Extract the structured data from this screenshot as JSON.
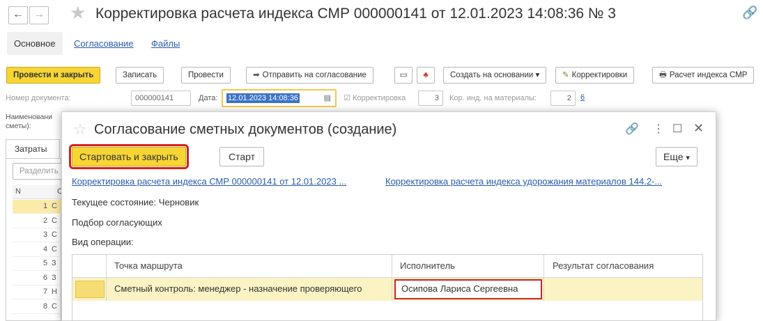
{
  "header": {
    "title": "Корректировка расчета индекса СМР 000000141 от 12.01.2023 14:08:36 № 3"
  },
  "tabs": [
    "Основное",
    "Согласование",
    "Файлы"
  ],
  "toolbar": {
    "post_close": "Провести и закрыть",
    "save": "Записать",
    "post": "Провести",
    "send_approval": "Отправить на согласование",
    "create_based": "Создать на основании",
    "corrections": "Корректировки",
    "index_calc": "Расчет индекса СМР"
  },
  "fields": {
    "doc_number_label": "Номер документа:",
    "doc_number": "000000141",
    "date_label": "Дата:",
    "date": "12.01.2023 14:08:36",
    "correction_label": "Корректировка",
    "correction_value": "3",
    "kor_ind_label": "Кор. инд. на материалы:",
    "kor_ind_value": "2",
    "kor_ind_link": "6",
    "name_label_1": "Наименовани",
    "name_label_2": "сметы):"
  },
  "left": {
    "tab": "Затраты",
    "split": "Разделить",
    "col_n": "N",
    "rows": [
      {
        "n": "1",
        "c": "С"
      },
      {
        "n": "2",
        "c": "С"
      },
      {
        "n": "3",
        "c": "С"
      },
      {
        "n": "4",
        "c": "С"
      },
      {
        "n": "5",
        "c": "З"
      },
      {
        "n": "6",
        "c": "З"
      },
      {
        "n": "7",
        "c": "Н"
      },
      {
        "n": "8",
        "c": "С"
      }
    ],
    "col_c": "С"
  },
  "modal": {
    "title": "Согласование сметных документов (создание)",
    "start_close": "Стартовать и закрыть",
    "start": "Старт",
    "more": "Еще",
    "link1": "Корректировка расчета индекса СМР 000000141 от 12.01.2023 ...",
    "link2": "Корректировка расчета индекса удорожания материалов 144.2-...",
    "state_label": "Текущее состояние:",
    "state_value": "Черновик",
    "selection": "Подбор согласующих",
    "operation": "Вид операции:",
    "table": {
      "headers": [
        "Точка маршрута",
        "Исполнитель",
        "Результат согласования"
      ],
      "row": {
        "point": "Сметный контроль: менеджер - назначение проверяющего",
        "executor": "Осипова Лариса Сергеевна",
        "result": ""
      }
    }
  },
  "colors": {
    "accent_yellow": "#f7d535",
    "link_blue": "#2a5cad",
    "highlight_red": "#d42020",
    "row_highlight": "#fbf3c4"
  }
}
